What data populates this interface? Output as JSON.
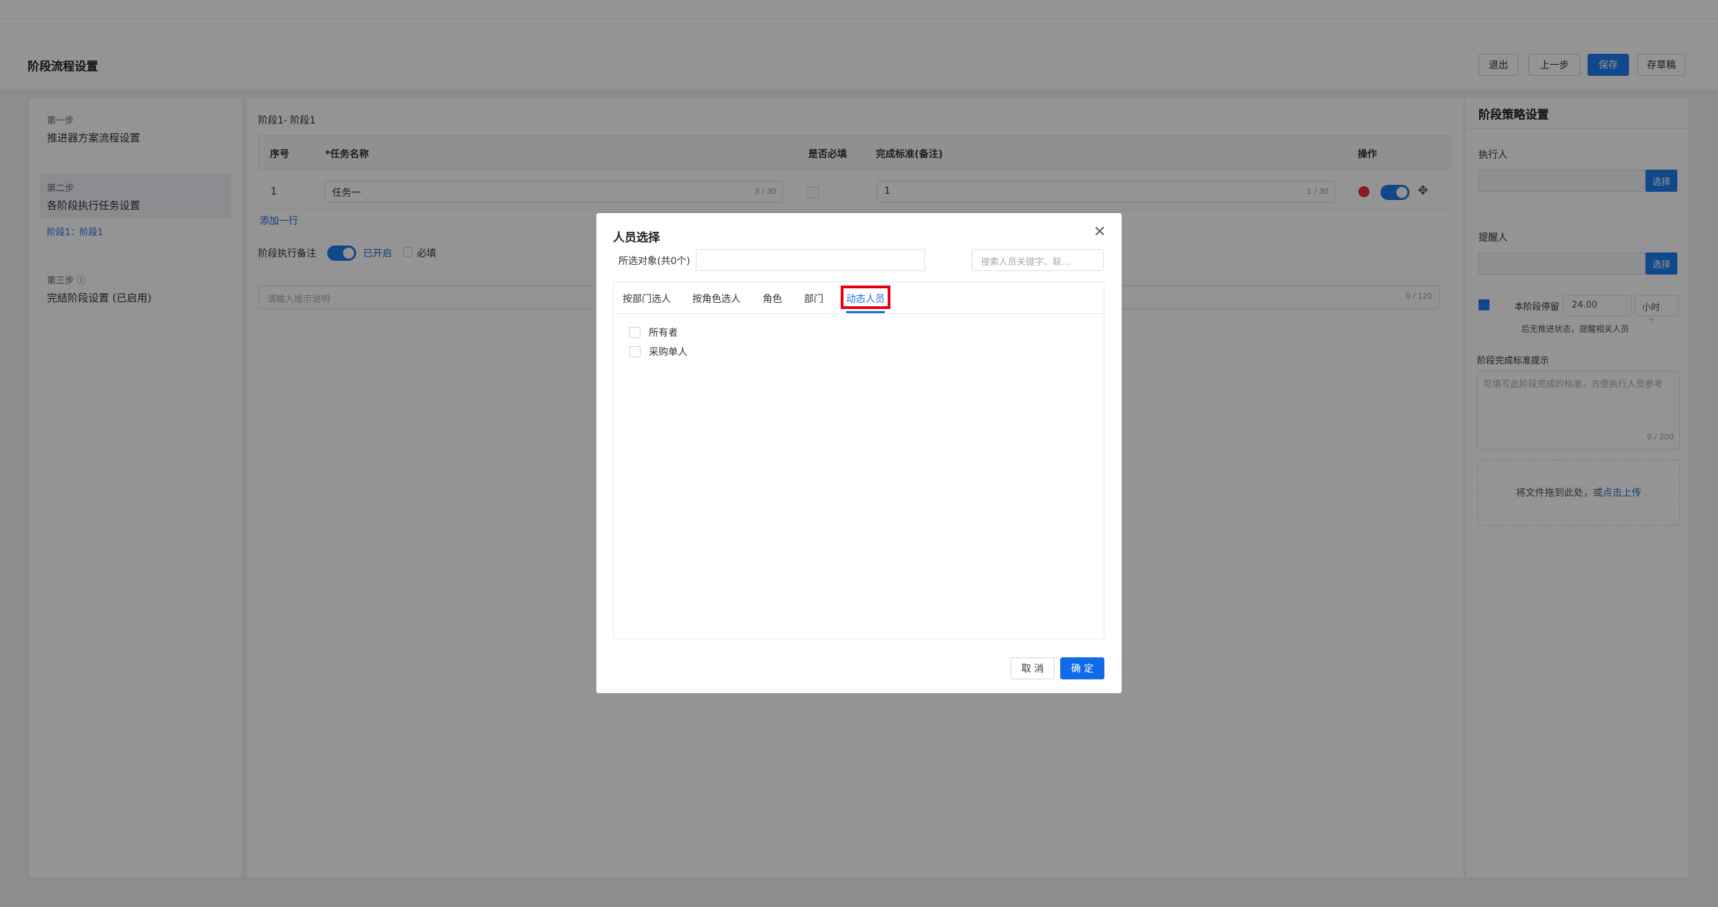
{
  "header": {
    "title": "阶段流程设置",
    "buttons": {
      "exit": "退出",
      "prev": "上一步",
      "save": "保存",
      "draft": "存草稿"
    }
  },
  "steps": {
    "step1": {
      "sub": "第一步",
      "label": "推进器方案流程设置"
    },
    "step2": {
      "sub": "第二步",
      "label": "各阶段执行任务设置",
      "link": "阶段1：阶段1"
    },
    "step3": {
      "sub": "第三步 ⓘ",
      "label": "完结阶段设置 (已启用)"
    }
  },
  "center": {
    "stage_label": "阶段1-  阶段1",
    "table": {
      "headers": [
        "序号",
        "*任务名称",
        "是否必填",
        "完成标准(备注)",
        "操作"
      ],
      "rows": [
        {
          "index": "1",
          "name": "任务一",
          "name_count": "3 / 30",
          "standard": "1",
          "standard_count": "1 / 30"
        }
      ]
    },
    "add_row": "添加一行",
    "note_label": "阶段执行备注",
    "note_status": "已开启",
    "required_label": "必填",
    "note_placeholder": "请输入提示说明",
    "note_count": "0 / 120"
  },
  "right_panel": {
    "title": "阶段策略设置",
    "executor_label": "执行人",
    "reminder_label": "提醒人",
    "select_btn": "选择",
    "stay_label": "本阶段停留",
    "stay_value": "24.00",
    "stay_unit": "小时",
    "stay_hint": "后无推进状态，提醒相关人员",
    "standard_label": "阶段完成标准提示",
    "standard_placeholder": "可填写此阶段完成的标准，方便执行人员参考",
    "standard_count": "0 / 200",
    "upload_text": "将文件拖到此处，或",
    "upload_link": "点击上传"
  },
  "dialog": {
    "title": "人员选择",
    "selected_label": "所选对象(共0个)",
    "search_placeholder": "搜索人员关键字、联...",
    "tabs": [
      "按部门选人",
      "按角色选人",
      "角色",
      "部门",
      "动态人员"
    ],
    "active_tab": "动态人员",
    "options": [
      "所有者",
      "采购单人"
    ],
    "cancel": "取 消",
    "confirm": "确 定"
  },
  "colors": {
    "primary": "#1e7bef",
    "highlight": "#e60012",
    "link": "#1e6fd9"
  }
}
